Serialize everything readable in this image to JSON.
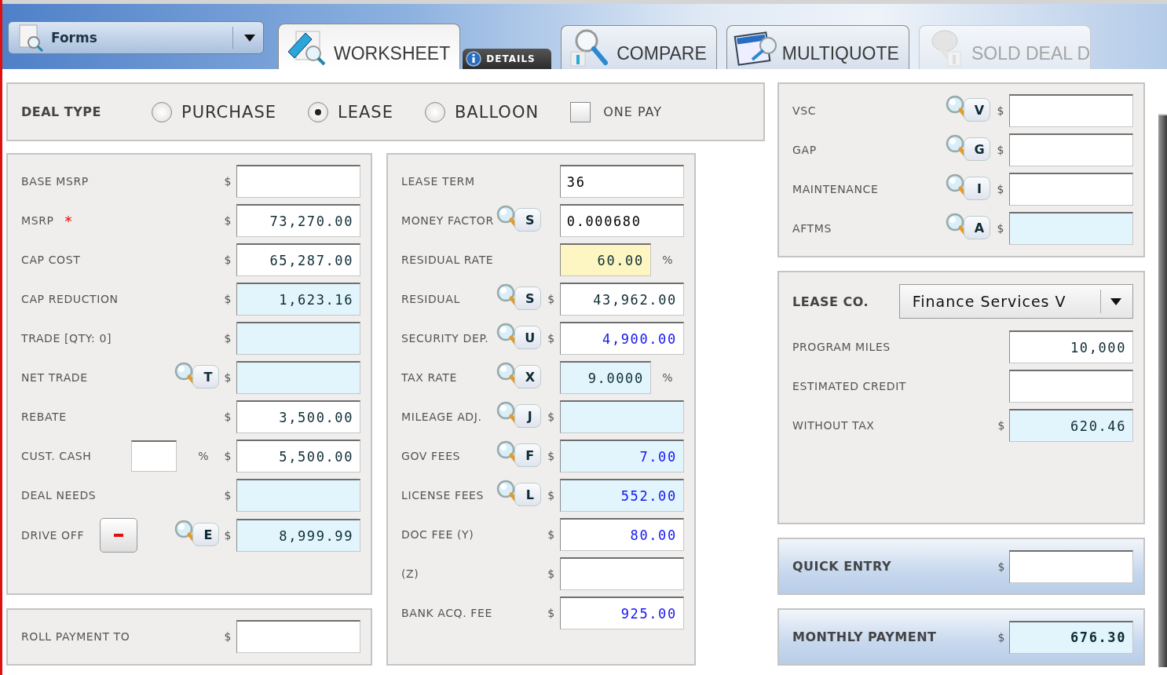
{
  "toolbar": {
    "forms_menu": {
      "label": "Forms"
    },
    "tabs": [
      {
        "label": "WORKSHEET",
        "kind": "worksheet",
        "selected": true,
        "disabled": false
      },
      {
        "label": "COMPARE",
        "kind": "compare",
        "selected": false,
        "disabled": false
      },
      {
        "label": "MULTIQUOTE",
        "kind": "multiquote",
        "selected": false,
        "disabled": false
      },
      {
        "label": "SOLD DEAL D",
        "kind": "sold",
        "selected": false,
        "disabled": true
      }
    ],
    "details_tab": {
      "label": "DETAILS"
    }
  },
  "deal_type": {
    "label": "DEAL TYPE",
    "options": [
      {
        "label": "PURCHASE",
        "selected": false
      },
      {
        "label": "LEASE",
        "selected": true
      },
      {
        "label": "BALLOON",
        "selected": false
      }
    ],
    "one_pay": {
      "label": "ONE PAY",
      "checked": false
    }
  },
  "left_panel": {
    "rows": [
      {
        "kind": "field",
        "label": "BASE MSRP",
        "unit": "$",
        "computed": false
      },
      {
        "kind": "field",
        "label": "MSRP",
        "required_mark": "*",
        "unit": "$",
        "value": "73,270.00",
        "color": "#0e2c34",
        "computed": false
      },
      {
        "kind": "field",
        "label": "CAP COST",
        "unit": "$",
        "value": "65,287.00",
        "color": "#0e2c34",
        "computed": false
      },
      {
        "kind": "field",
        "label": "CAP REDUCTION",
        "unit": "$",
        "value": "1,623.16",
        "color": "#0e2c34",
        "computed": true
      },
      {
        "kind": "field",
        "label": "TRADE [QTY: 0]",
        "unit": "$",
        "computed": true
      },
      {
        "kind": "field",
        "label": "NET TRADE",
        "lookup": "T",
        "unit": "$",
        "computed": true
      },
      {
        "kind": "field",
        "label": "REBATE",
        "unit": "$",
        "value": "3,500.00",
        "color": "#0e2c34",
        "computed": false
      },
      {
        "kind": "split",
        "label": "CUST. CASH",
        "split_unit": "%",
        "unit": "$",
        "value": "5,500.00",
        "color": "#0e2c34",
        "computed": false
      },
      {
        "kind": "field",
        "label": "DEAL NEEDS",
        "unit": "$",
        "computed": true
      },
      {
        "kind": "remove",
        "label": "DRIVE OFF",
        "lookup": "E",
        "unit": "$",
        "value": "8,999.99",
        "color": "#0e2c34",
        "computed": true
      }
    ]
  },
  "roll_payment": {
    "rows": [
      {
        "label": "ROLL PAYMENT TO",
        "unit": "$",
        "computed": false
      }
    ]
  },
  "middle_panel": {
    "rows": [
      {
        "label": "LEASE TERM",
        "value": "36",
        "color": "#000000",
        "left_aligned": true,
        "computed": false,
        "highlighted": false
      },
      {
        "label": "MONEY FACTOR",
        "lookup": "S",
        "value": "0.000680",
        "color": "#000000",
        "left_aligned": true,
        "computed": false,
        "highlighted": false
      },
      {
        "label": "RESIDUAL RATE",
        "value": "60.00",
        "color": "#0e2c34",
        "suffix": "%",
        "highlighted": true
      },
      {
        "label": "RESIDUAL",
        "lookup": "S",
        "unit": "$",
        "value": "43,962.00",
        "color": "#0e2c34",
        "computed": false,
        "highlighted": false
      },
      {
        "label": "SECURITY DEP.",
        "lookup": "U",
        "unit": "$",
        "value": "4,900.00",
        "color": "#1414f0",
        "computed": false,
        "highlighted": false
      },
      {
        "label": "TAX RATE",
        "lookup": "X",
        "value": "9.0000",
        "color": "#0e2c34",
        "suffix": "%",
        "computed": true,
        "highlighted": false
      },
      {
        "label": "MILEAGE ADJ.",
        "lookup": "J",
        "unit": "$",
        "computed": true,
        "highlighted": false
      },
      {
        "label": "GOV FEES",
        "lookup": "F",
        "unit": "$",
        "value": "7.00",
        "color": "#1414f0",
        "computed": true,
        "highlighted": false
      },
      {
        "label": "LICENSE FEES",
        "lookup": "L",
        "unit": "$",
        "value": "552.00",
        "color": "#1414f0",
        "computed": true,
        "highlighted": false
      },
      {
        "label": "DOC FEE (Y)",
        "unit": "$",
        "value": "80.00",
        "color": "#1414f0",
        "computed": false,
        "highlighted": false
      },
      {
        "label": "(Z)",
        "unit": "$",
        "computed": false,
        "highlighted": false
      },
      {
        "label": "BANK ACQ. FEE",
        "unit": "$",
        "value": "925.00",
        "color": "#1414f0",
        "computed": false,
        "highlighted": false
      }
    ]
  },
  "products_panel": {
    "rows": [
      {
        "label": "VSC",
        "lookup": "V",
        "unit": "$",
        "computed": false
      },
      {
        "label": "GAP",
        "lookup": "G",
        "unit": "$",
        "computed": false
      },
      {
        "label": "MAINTENANCE",
        "lookup": "I",
        "unit": "$",
        "computed": false
      },
      {
        "label": "AFTMS",
        "lookup": "A",
        "unit": "$",
        "computed": true
      }
    ]
  },
  "lease_co_panel": {
    "label": "LEASE CO.",
    "dropdown": {
      "value": "Finance Services V"
    },
    "rows": [
      {
        "label": "PROGRAM MILES",
        "value": "10,000",
        "color": "#0e2c34",
        "computed": false
      },
      {
        "label": "ESTIMATED CREDIT",
        "computed": false
      },
      {
        "label": "WITHOUT TAX",
        "unit": "$",
        "value": "620.46",
        "color": "#0e2c34",
        "computed": true
      }
    ]
  },
  "quick_entry": {
    "label": "QUICK ENTRY",
    "unit": "$",
    "computed": false
  },
  "monthly_payment": {
    "label": "MONTHLY PAYMENT",
    "unit": "$",
    "value": "676.30",
    "color": "#0e2c34",
    "computed": true
  }
}
